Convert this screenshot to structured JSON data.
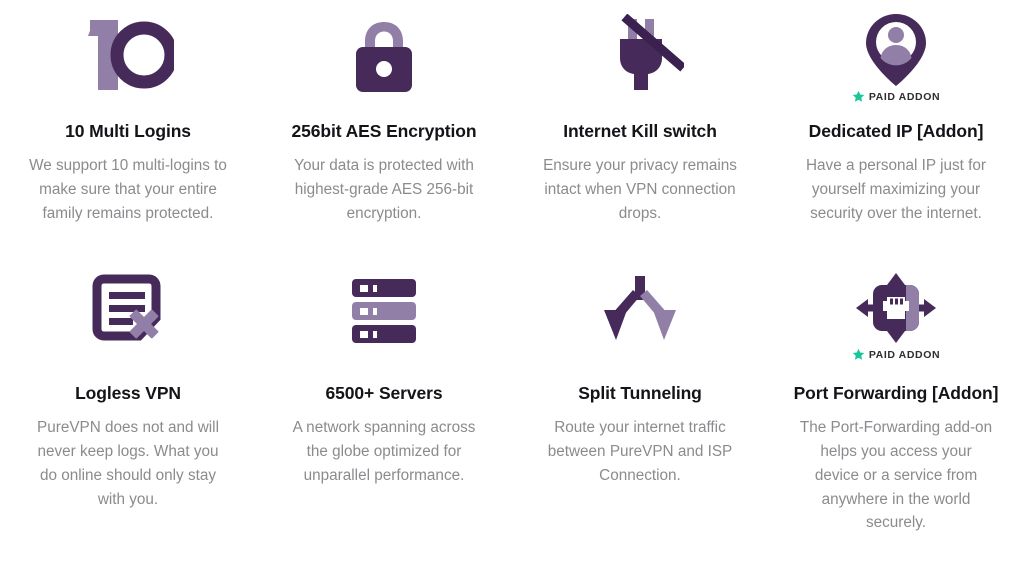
{
  "colors": {
    "dark_purple": "#452a5a",
    "light_purple": "#927fa8",
    "teal_star": "#17c79a",
    "title_text": "#141418",
    "body_text": "#8b8b8f",
    "background": "#ffffff"
  },
  "badge": {
    "label": "PAID ADDON",
    "icon": "star-icon"
  },
  "features": [
    {
      "id": "multi-logins",
      "icon": "ten-number-icon",
      "title": "10 Multi Logins",
      "description": "We support 10 multi-logins to make sure that your entire family remains protected.",
      "paid_addon": false
    },
    {
      "id": "aes-encryption",
      "icon": "padlock-icon",
      "title": "256bit AES Encryption",
      "description": "Your data is protected with highest-grade AES 256-bit encryption.",
      "paid_addon": false
    },
    {
      "id": "kill-switch",
      "icon": "plug-disconnected-icon",
      "title": "Internet Kill switch",
      "description": "Ensure your privacy remains intact when VPN connection drops.",
      "paid_addon": false
    },
    {
      "id": "dedicated-ip",
      "icon": "map-pin-user-icon",
      "title": "Dedicated IP [Addon]",
      "description": "Have a personal IP just for yourself maximizing your security over the internet.",
      "paid_addon": true
    },
    {
      "id": "logless-vpn",
      "icon": "document-no-logs-icon",
      "title": "Logless VPN",
      "description": "PureVPN does not and will never keep logs. What you do online should only stay with you.",
      "paid_addon": false
    },
    {
      "id": "servers",
      "icon": "server-stack-icon",
      "title": "6500+ Servers",
      "description": "A network spanning across the globe optimized for unparallel performance.",
      "paid_addon": false
    },
    {
      "id": "split-tunneling",
      "icon": "split-arrows-icon",
      "title": "Split Tunneling",
      "description": "Route your internet traffic between PureVPN and ISP Connection.",
      "paid_addon": false
    },
    {
      "id": "port-forwarding",
      "icon": "ethernet-port-arrows-icon",
      "title": "Port Forwarding [Addon]",
      "description": "The Port-Forwarding add-on helps you access your device or a service from anywhere in the world securely.",
      "paid_addon": true
    }
  ]
}
